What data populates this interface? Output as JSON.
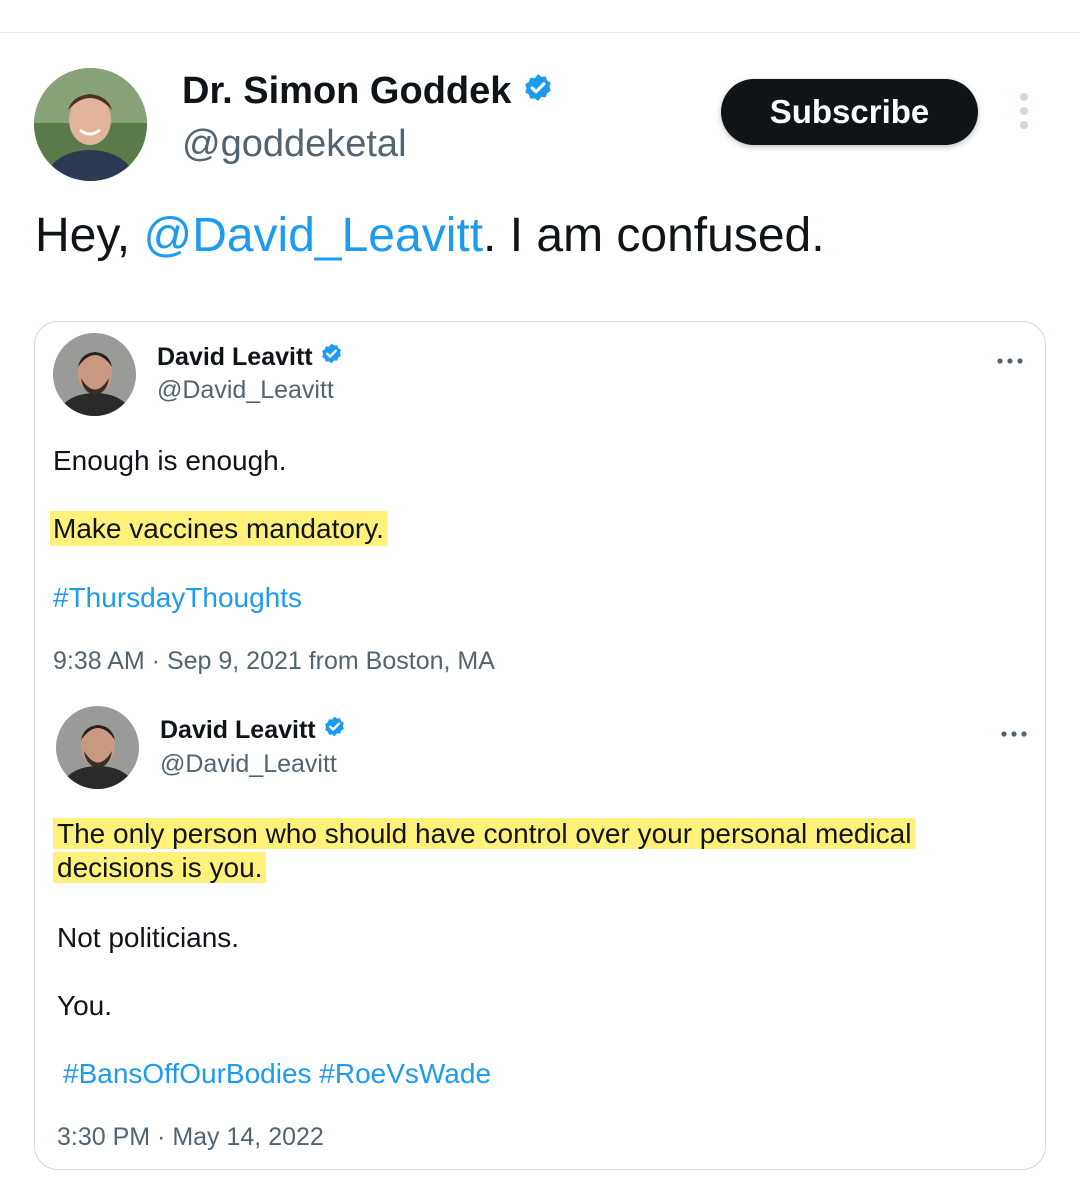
{
  "author": {
    "name": "Dr. Simon Goddek",
    "handle": "@goddeketal",
    "subscribe_label": "Subscribe"
  },
  "tweet": {
    "prefix": "Hey, ",
    "mention": "@David_Leavitt",
    "suffix": ". I am confused."
  },
  "quoted": [
    {
      "name": "David Leavitt",
      "handle": "@David_Leavitt",
      "line1": "Enough is enough.",
      "line2": "Make vaccines mandatory.",
      "hashtag": "#ThursdayThoughts",
      "timestamp": "9:38 AM · Sep 9, 2021 from Boston, MA"
    },
    {
      "name": "David Leavitt",
      "handle": "@David_Leavitt",
      "highlight_line1": "The only person who should have control over your personal medical",
      "highlight_line2": "decisions is you.",
      "line3": "Not politicians.",
      "line4": "You.",
      "hashtags": "#BansOffOurBodies #RoeVsWade",
      "timestamp": "3:30 PM · May 14, 2022"
    }
  ],
  "icons": {
    "verified": "verified-badge-icon",
    "more": "more-options-icon"
  },
  "colors": {
    "link": "#1d9bf0",
    "highlight": "#fff17a",
    "button": "#0f1419",
    "secondary_text": "#536471"
  }
}
